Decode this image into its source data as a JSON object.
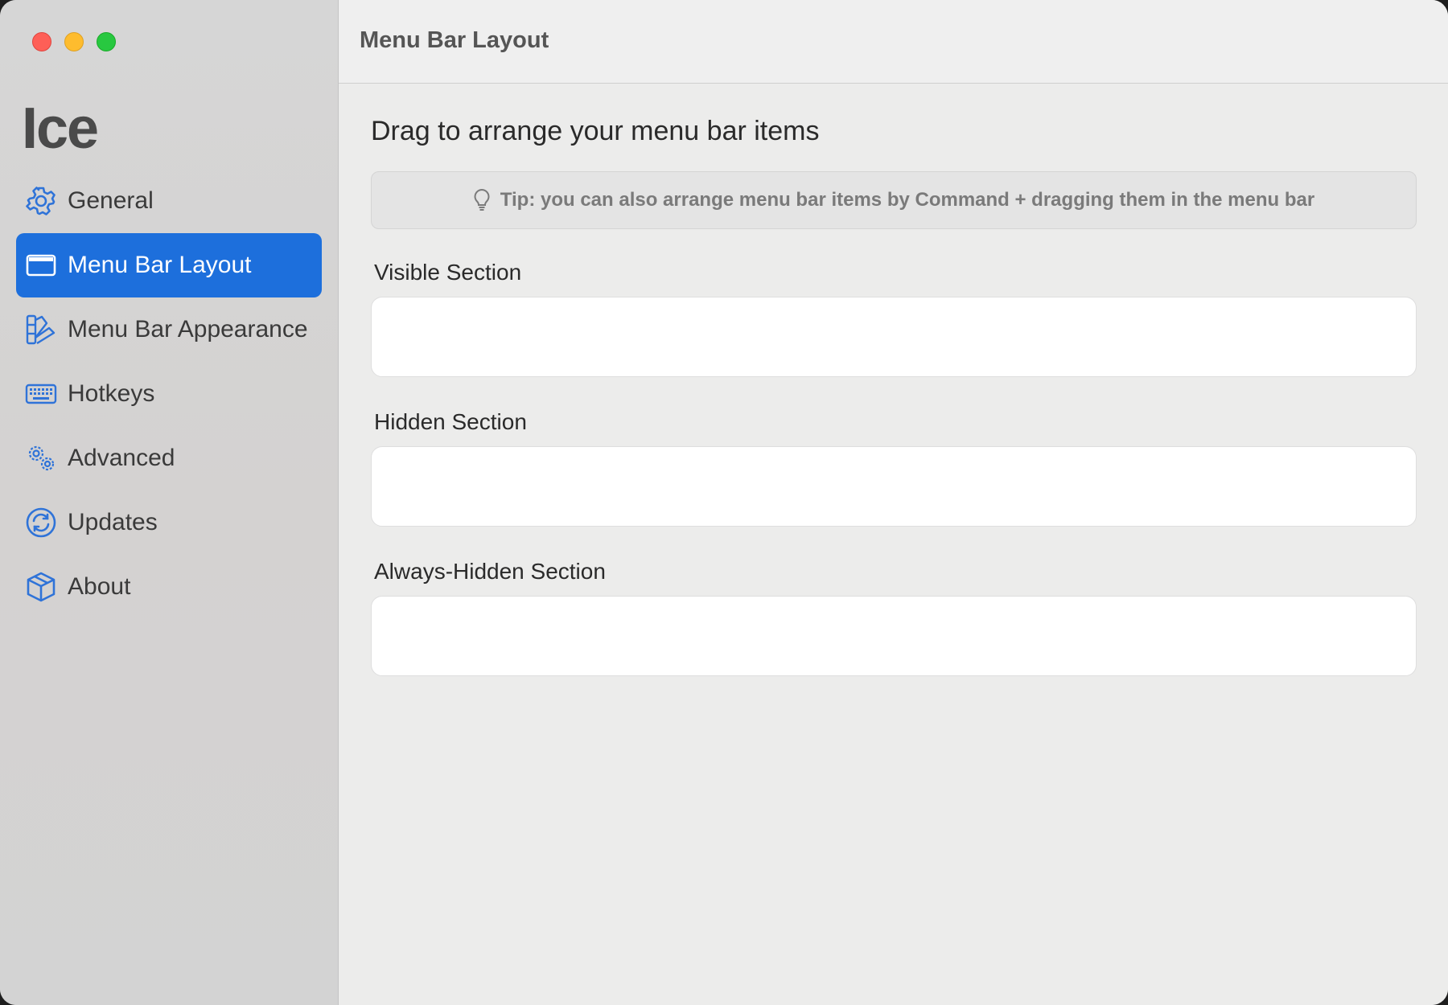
{
  "window": {
    "traffic_lights": [
      "close",
      "minimize",
      "zoom"
    ]
  },
  "sidebar": {
    "app_title": "Ice",
    "items": [
      {
        "label": "General",
        "icon": "gear-icon",
        "active": false
      },
      {
        "label": "Menu Bar Layout",
        "icon": "menubar-layout-icon",
        "active": true
      },
      {
        "label": "Menu Bar Appearance",
        "icon": "swatch-palette-icon",
        "active": false
      },
      {
        "label": "Hotkeys",
        "icon": "keyboard-icon",
        "active": false
      },
      {
        "label": "Advanced",
        "icon": "gears-icon",
        "active": false
      },
      {
        "label": "Updates",
        "icon": "refresh-circle-icon",
        "active": false
      },
      {
        "label": "About",
        "icon": "cube-icon",
        "active": false
      }
    ],
    "accent_color": "#1d6fdc",
    "icon_color": "#2f73d8"
  },
  "toolbar": {
    "title": "Menu Bar Layout"
  },
  "main": {
    "heading": "Drag to arrange your menu bar items",
    "tip": "Tip: you can also arrange menu bar items by Command + dragging them in the menu bar",
    "sections": [
      {
        "label": "Visible Section"
      },
      {
        "label": "Hidden Section"
      },
      {
        "label": "Always-Hidden Section"
      }
    ]
  }
}
